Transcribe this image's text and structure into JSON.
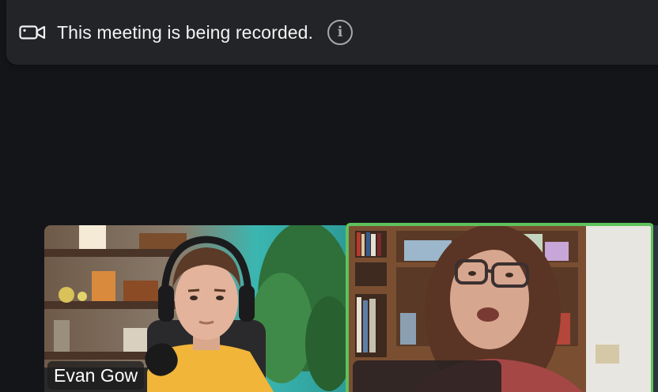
{
  "banner": {
    "message": "This meeting is being recorded.",
    "camera_icon": "video-camera-icon",
    "info_icon": "info-icon",
    "info_glyph": "i"
  },
  "participants": [
    {
      "name": "Evan Gow",
      "role": "participant"
    },
    {
      "name": "",
      "role": "active-speaker"
    }
  ],
  "colors": {
    "background": "#141519",
    "banner": "#232427",
    "active_speaker_border": "#5fc25c"
  }
}
